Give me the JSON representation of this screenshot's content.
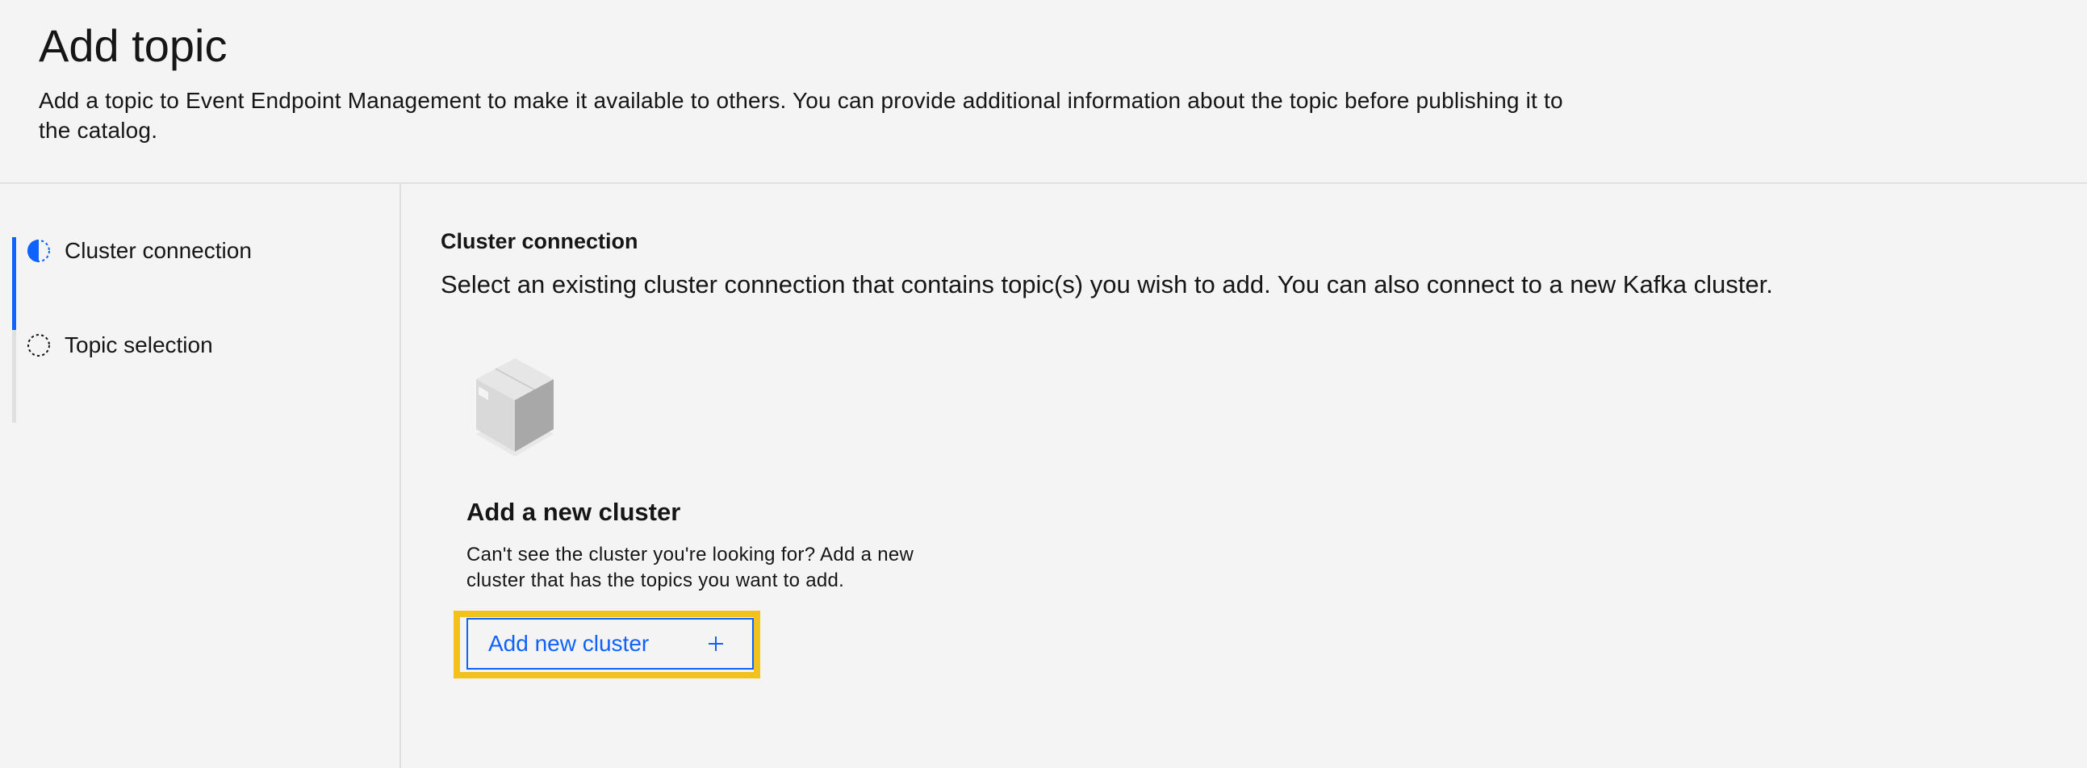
{
  "header": {
    "title": "Add topic",
    "description": "Add a topic to Event Endpoint Management to make it available to others. You can provide additional information about the topic before publishing it to the catalog."
  },
  "progress": {
    "steps": [
      {
        "label": "Cluster connection",
        "state": "current",
        "icon": "half-filled-circle-icon"
      },
      {
        "label": "Topic selection",
        "state": "incomplete",
        "icon": "dashed-circle-icon"
      }
    ]
  },
  "main": {
    "section_title": "Cluster connection",
    "section_description": "Select an existing cluster connection that contains topic(s) you wish to add. You can also connect to a new Kafka cluster.",
    "new_cluster_card": {
      "illustration": "cube-box-icon",
      "title": "Add a new cluster",
      "description": "Can't see the cluster you're looking for? Add a new cluster that has the topics you want to add.",
      "button_label": "Add new cluster",
      "button_icon": "plus-icon"
    }
  },
  "colors": {
    "accent": "#0f62fe",
    "highlight": "#f1c21b",
    "background": "#f4f4f4",
    "text": "#161616",
    "border": "#e0e0e0"
  }
}
